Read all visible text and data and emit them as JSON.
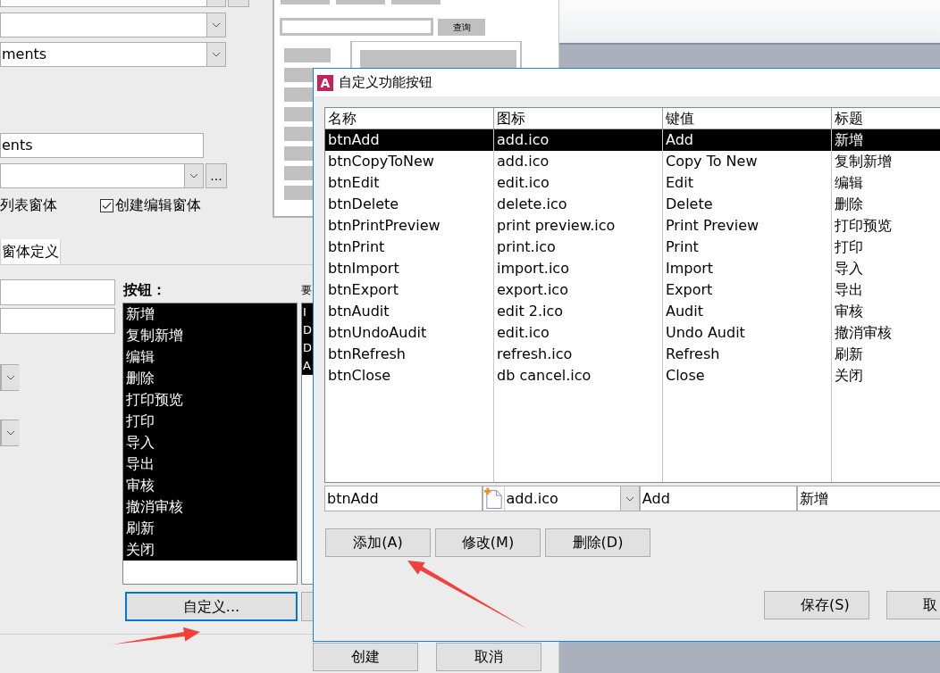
{
  "form": {
    "combo_3": {
      "value": "ments"
    },
    "name_field": {
      "value": "ents"
    },
    "combo_4": {
      "browse": "..."
    },
    "options": [
      {
        "label": "列表窗体",
        "kind": "text"
      },
      {
        "label": "创建编辑窗体",
        "kind": "checkbox",
        "checked": true
      }
    ],
    "preview": {
      "search_button": "查询"
    },
    "tabs": [
      {
        "label": "窗体定义",
        "selected": true
      }
    ],
    "buttons_label": "按钮：",
    "button_items": [
      {
        "label": "新增",
        "selected": true
      },
      {
        "label": "复制新增",
        "selected": true
      },
      {
        "label": "编辑",
        "selected": true
      },
      {
        "label": "删除",
        "selected": true
      },
      {
        "label": "打印预览",
        "selected": true
      },
      {
        "label": "打印",
        "selected": true
      },
      {
        "label": "导入",
        "selected": true
      },
      {
        "label": "导出",
        "selected": true
      },
      {
        "label": "审核",
        "selected": true
      },
      {
        "label": "撤消审核",
        "selected": true
      },
      {
        "label": "刷新",
        "selected": true
      },
      {
        "label": "关闭",
        "selected": true
      }
    ],
    "customize_button": {
      "label": "自定义...",
      "focused": true
    },
    "fields_label": "要",
    "field_items": [
      {
        "label": "I",
        "selected": true
      },
      {
        "label": "D",
        "selected": true
      },
      {
        "label": "D",
        "selected": true
      },
      {
        "label": "A",
        "selected": true
      }
    ],
    "footer_buttons": [
      "创建",
      "取消"
    ]
  },
  "dialog": {
    "icon_letter": "A",
    "title": "自定义功能按钮",
    "columns": [
      "名称",
      "图标",
      "键值",
      "标题"
    ],
    "rows": [
      {
        "cells": [
          "btnAdd",
          "add.ico",
          "Add",
          "新增"
        ],
        "selected": true
      },
      {
        "cells": [
          "btnCopyToNew",
          "add.ico",
          "Copy To New",
          "复制新增"
        ],
        "selected": false
      },
      {
        "cells": [
          "btnEdit",
          "edit.ico",
          "Edit",
          "编辑"
        ],
        "selected": false
      },
      {
        "cells": [
          "btnDelete",
          "delete.ico",
          "Delete",
          "删除"
        ],
        "selected": false
      },
      {
        "cells": [
          "btnPrintPreview",
          "print preview.ico",
          "Print Preview",
          "打印预览"
        ],
        "selected": false
      },
      {
        "cells": [
          "btnPrint",
          "print.ico",
          "Print",
          "打印"
        ],
        "selected": false
      },
      {
        "cells": [
          "btnImport",
          "import.ico",
          "Import",
          "导入"
        ],
        "selected": false
      },
      {
        "cells": [
          "btnExport",
          "export.ico",
          "Export",
          "导出"
        ],
        "selected": false
      },
      {
        "cells": [
          "btnAudit",
          "edit 2.ico",
          "Audit",
          "审核"
        ],
        "selected": false
      },
      {
        "cells": [
          "btnUndoAudit",
          "edit.ico",
          "Undo Audit",
          "撤消审核"
        ],
        "selected": false
      },
      {
        "cells": [
          "btnRefresh",
          "refresh.ico",
          "Refresh",
          "刷新"
        ],
        "selected": false
      },
      {
        "cells": [
          "btnClose",
          "db cancel.ico",
          "Close",
          "关闭"
        ],
        "selected": false
      }
    ],
    "editor": {
      "name": "btnAdd",
      "icon": "add.ico",
      "key": "Add",
      "caption": "新增"
    },
    "action_buttons": [
      "添加(A)",
      "修改(M)",
      "删除(D)"
    ],
    "footer_buttons": [
      "保存(S)",
      "取"
    ]
  }
}
